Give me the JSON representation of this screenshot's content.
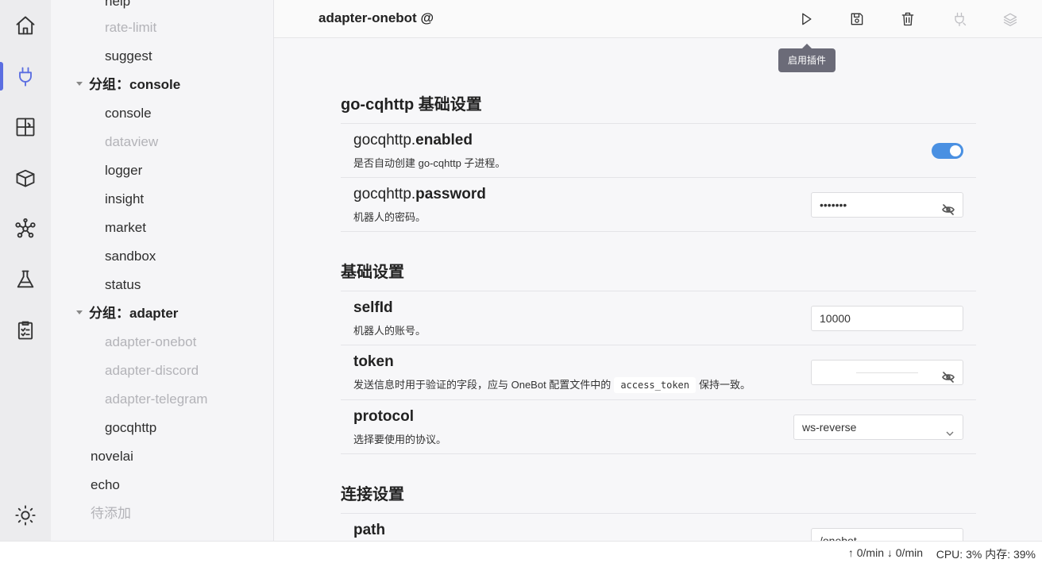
{
  "activity_bar": {
    "items": [
      {
        "name": "home-icon"
      },
      {
        "name": "plugin-icon"
      },
      {
        "name": "dependencies-icon"
      },
      {
        "name": "market-icon"
      },
      {
        "name": "network-icon"
      },
      {
        "name": "sandbox-icon"
      },
      {
        "name": "logs-icon"
      }
    ],
    "theme_icon": "sun-icon",
    "accent": "#5b6ee1"
  },
  "sidebar": {
    "items": [
      {
        "label": "help",
        "dim": false
      },
      {
        "label": "rate-limit",
        "dim": true
      },
      {
        "label": "suggest",
        "dim": false
      },
      {
        "label": "分组：console",
        "group": true
      },
      {
        "label": "console",
        "dim": false
      },
      {
        "label": "dataview",
        "dim": true
      },
      {
        "label": "logger",
        "dim": false
      },
      {
        "label": "insight",
        "dim": false
      },
      {
        "label": "market",
        "dim": false
      },
      {
        "label": "sandbox",
        "dim": false
      },
      {
        "label": "status",
        "dim": false
      },
      {
        "label": "分组：adapter",
        "group": true
      },
      {
        "label": "adapter-onebot",
        "dim": true
      },
      {
        "label": "adapter-discord",
        "dim": true
      },
      {
        "label": "adapter-telegram",
        "dim": true
      },
      {
        "label": "gocqhttp",
        "dim": false
      },
      {
        "label": "novelai",
        "dim": false
      },
      {
        "label": "echo",
        "dim": false
      },
      {
        "label": "待添加",
        "dim": true
      }
    ]
  },
  "header": {
    "title": "adapter-onebot @",
    "actions": [
      "play-icon",
      "save-icon",
      "trash-icon",
      "plug-icon",
      "layers-icon"
    ],
    "tooltip": "启用插件"
  },
  "sections": {
    "gocq": {
      "title": "go-cqhttp 基础设置",
      "enabled": {
        "prefix": "gocqhttp.",
        "key": "enabled",
        "desc": "是否自动创建 go-cqhttp 子进程。",
        "value": true
      },
      "password": {
        "prefix": "gocqhttp.",
        "key": "password",
        "desc": "机器人的密码。",
        "value": "•••••••"
      }
    },
    "basic": {
      "title": "基础设置",
      "selfId": {
        "key": "selfId",
        "desc": "机器人的账号。",
        "value": "10000"
      },
      "token": {
        "key": "token",
        "desc_before": "发送信息时用于验证的字段，应与 OneBot 配置文件中的",
        "desc_code": "access_token",
        "desc_after": "保持一致。",
        "value": ""
      },
      "protocol": {
        "key": "protocol",
        "desc": "选择要使用的协议。",
        "value": "ws-reverse"
      }
    },
    "connection": {
      "title": "连接设置",
      "path": {
        "key": "path",
        "value": "/onebot"
      }
    }
  },
  "statusbar": {
    "net": "↑ 0/min ↓ 0/min",
    "cpu": "CPU: 3% 内存: 39%"
  }
}
